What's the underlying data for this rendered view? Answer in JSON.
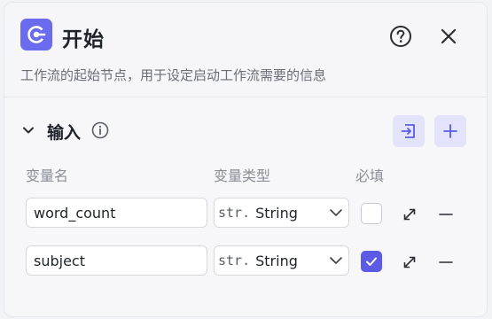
{
  "node": {
    "title": "开始",
    "description": "工作流的起始节点，用于设定启动工作流需要的信息",
    "icon": "start-node-icon",
    "accent_color": "#6b6bf0"
  },
  "header_actions": {
    "help_icon": "question-circle-icon",
    "close_icon": "close-icon"
  },
  "input_section": {
    "title": "输入",
    "info_icon": "info-circle-icon",
    "import_icon": "import-icon",
    "add_icon": "plus-icon",
    "columns": {
      "name": "变量名",
      "type": "变量类型",
      "required": "必填"
    },
    "rows": [
      {
        "name": "word_count",
        "type_prefix": "str.",
        "type": "String",
        "required": false
      },
      {
        "name": "subject",
        "type_prefix": "str.",
        "type": "String",
        "required": true
      }
    ]
  }
}
